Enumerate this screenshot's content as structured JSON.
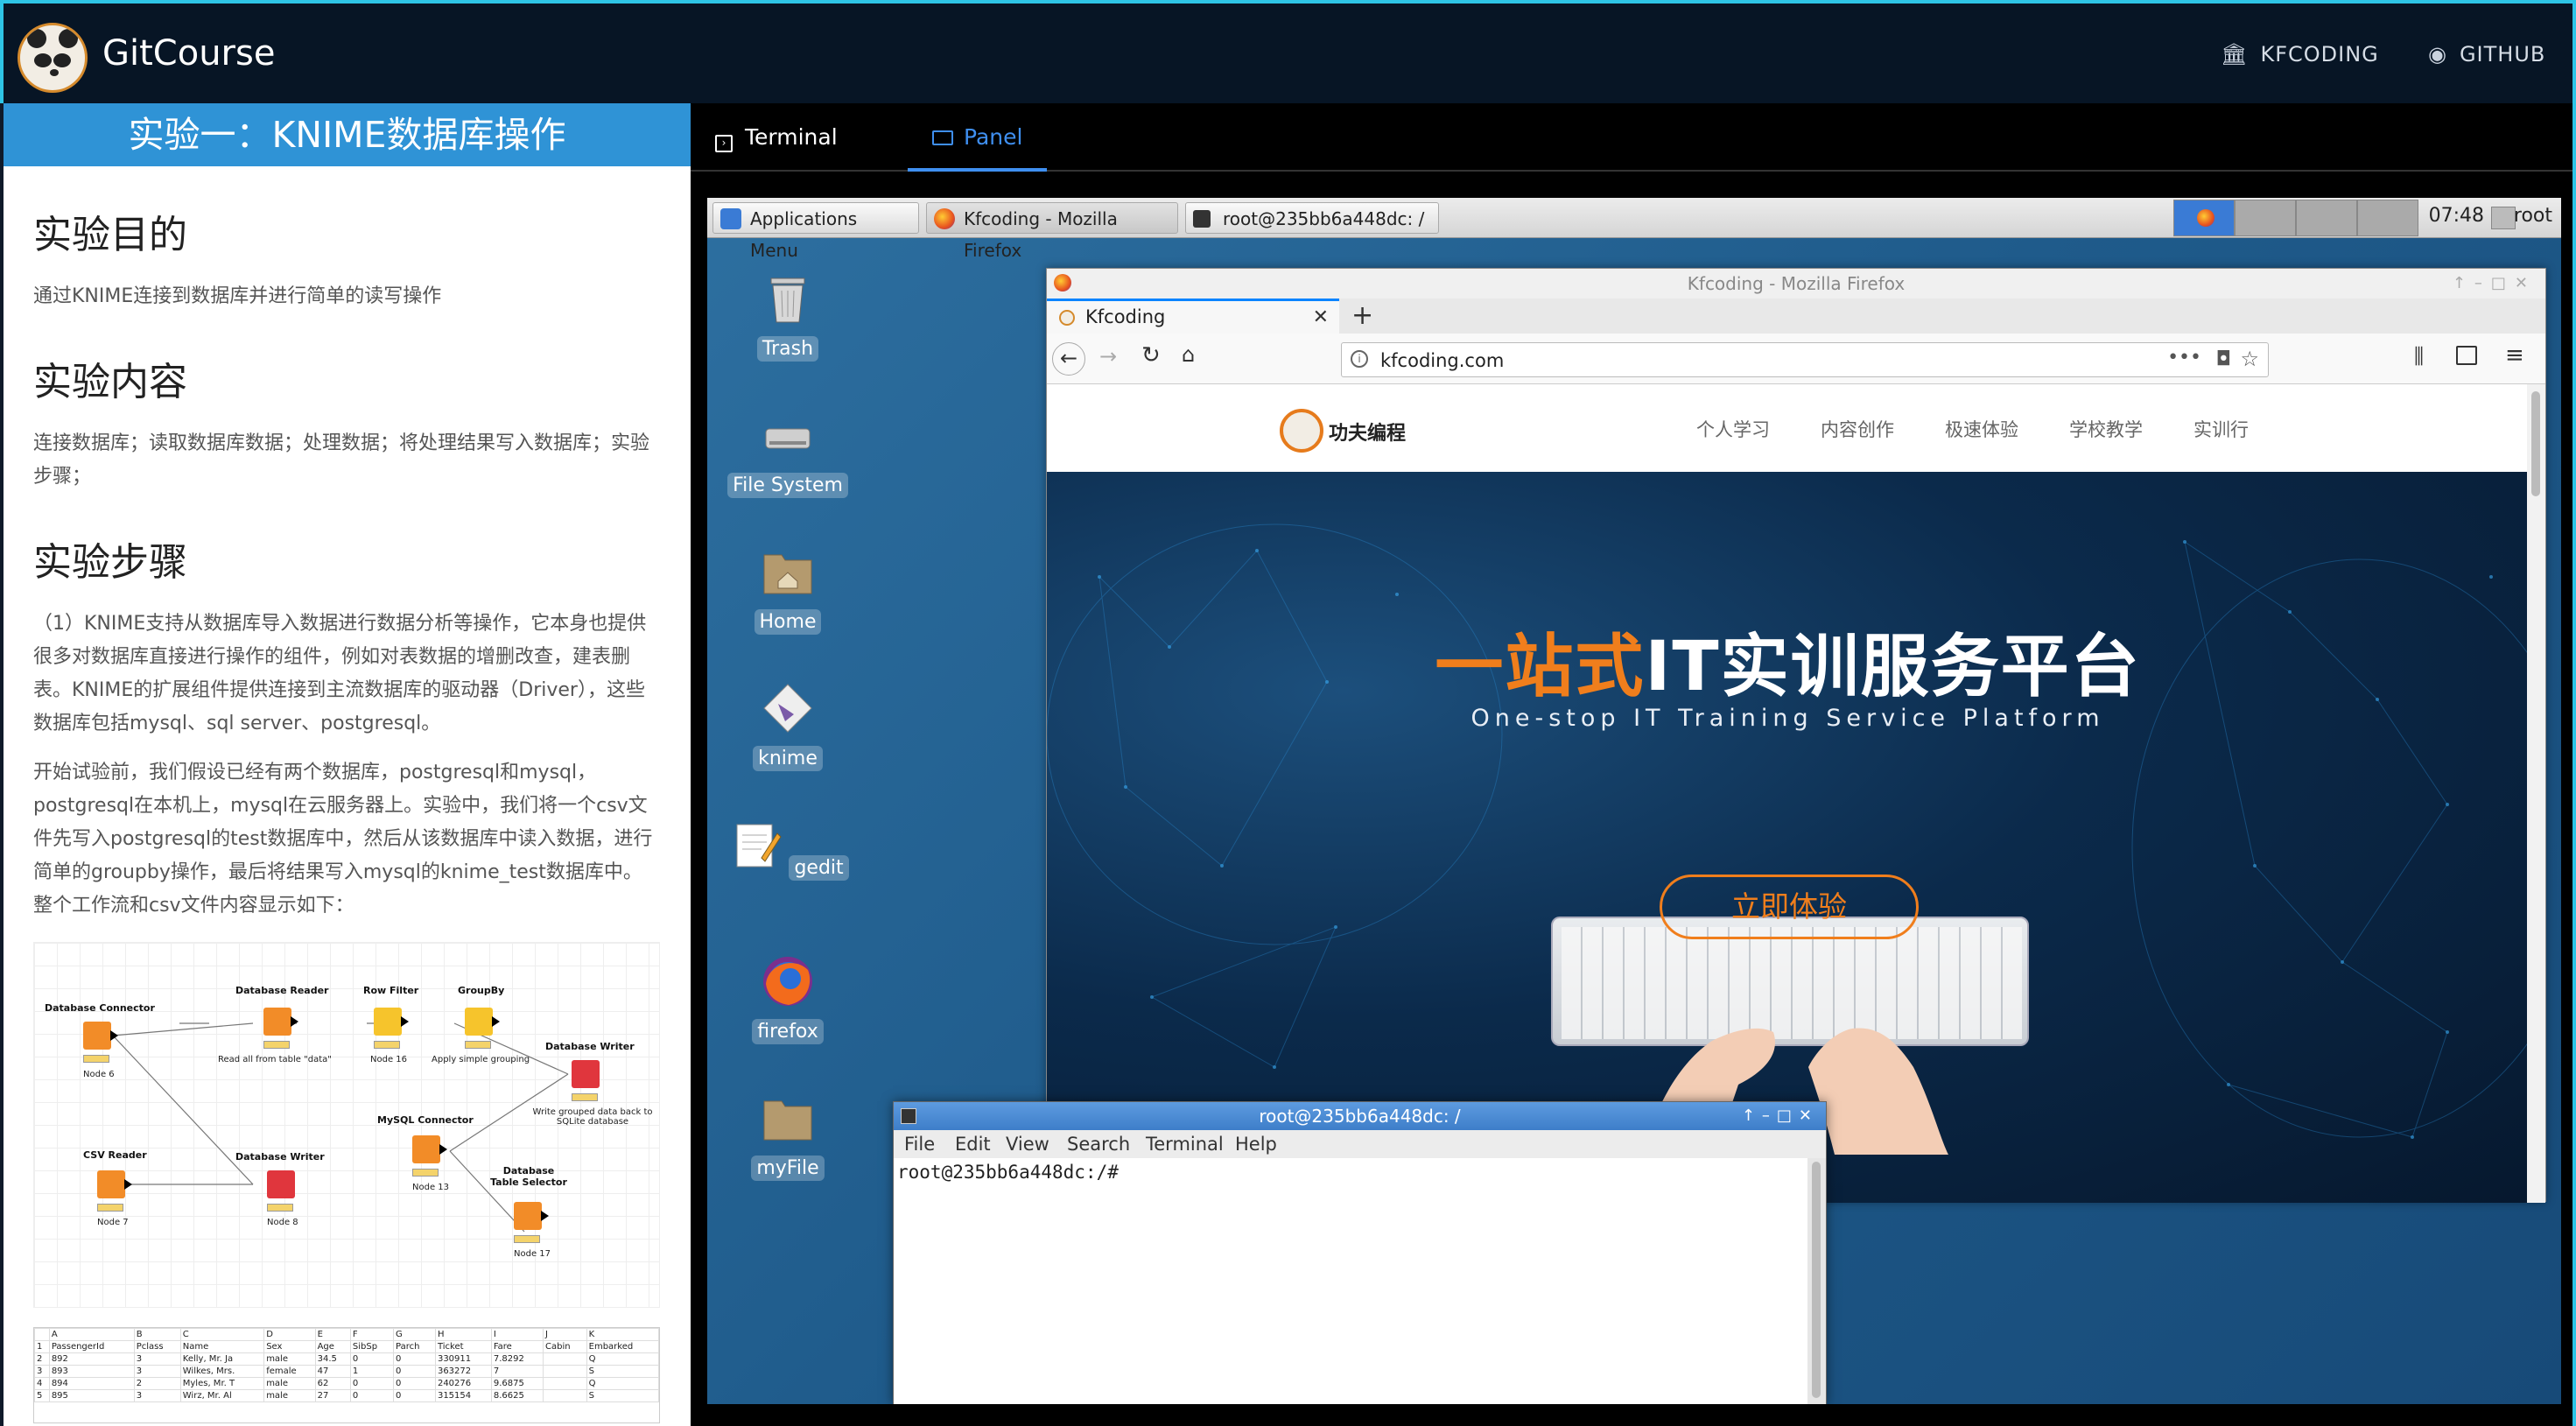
{
  "header": {
    "brand": "GitCourse",
    "links": [
      {
        "label": "KFCODING",
        "icon": "bank-icon"
      },
      {
        "label": "GITHUB",
        "icon": "github-icon"
      }
    ],
    "accent": "#2ec4e6"
  },
  "lesson": {
    "title": "实验一：KNIME数据库操作",
    "sections": [
      {
        "heading": "实验目的",
        "text": "通过KNIME连接到数据库并进行简单的读写操作"
      },
      {
        "heading": "实验内容",
        "text": "连接数据库；读取数据库数据；处理数据；将处理结果写入数据库；实验步骤；"
      },
      {
        "heading": "实验步骤",
        "paragraphs": [
          "（1）KNIME支持从数据库导入数据进行数据分析等操作，它本身也提供很多对数据库直接进行操作的组件，例如对表数据的增删改查，建表删表。KNIME的扩展组件提供连接到主流数据库的驱动器（Driver），这些数据库包括mysql、sql server、postgresql。",
          "开始试验前，我们假设已经有两个数据库，postgresql和mysql，postgresql在本机上，mysql在云服务器上。实验中，我们将一个csv文件先写入postgresql的test数据库中，然后从该数据库中读入数据，进行简单的groupby操作，最后将结果写入mysql的knime_test数据库中。整个工作流和csv文件内容显示如下："
        ]
      }
    ],
    "workflow": {
      "nodes": [
        {
          "title": "Database Connector",
          "sub": "Node 6"
        },
        {
          "title": "Database Reader",
          "sub": "Read all from table \"data\""
        },
        {
          "title": "Row Filter",
          "sub": "Node 16"
        },
        {
          "title": "GroupBy",
          "sub": "Apply simple grouping"
        },
        {
          "title": "Database Writer",
          "sub": "Write grouped data back to SQLite database"
        },
        {
          "title": "MySQL Connector",
          "sub": "Node 13"
        },
        {
          "title": "CSV Reader",
          "sub": "Node 7"
        },
        {
          "title": "Database Writer",
          "sub": "Node 8"
        },
        {
          "title": "Database Table Selector",
          "sub": "Node 17"
        }
      ]
    },
    "csv": {
      "columns": [
        "",
        "A",
        "B",
        "C",
        "D",
        "E",
        "F",
        "G",
        "H",
        "I",
        "J",
        "K"
      ],
      "rows": [
        [
          "1",
          "PassengerId",
          "Pclass",
          "Name",
          "Sex",
          "Age",
          "SibSp",
          "Parch",
          "Ticket",
          "Fare",
          "Cabin",
          "Embarked"
        ],
        [
          "2",
          "892",
          "3",
          "Kelly, Mr. Ja",
          "male",
          "34.5",
          "0",
          "0",
          "330911",
          "7.8292",
          "",
          "Q"
        ],
        [
          "3",
          "893",
          "3",
          "Wilkes, Mrs.",
          "female",
          "47",
          "1",
          "0",
          "363272",
          "7",
          "",
          "S"
        ],
        [
          "4",
          "894",
          "2",
          "Myles, Mr. T",
          "male",
          "62",
          "0",
          "0",
          "240276",
          "9.6875",
          "",
          "Q"
        ],
        [
          "5",
          "895",
          "3",
          "Wirz, Mr. Al",
          "male",
          "27",
          "0",
          "0",
          "315154",
          "8.6625",
          "",
          "S"
        ]
      ]
    }
  },
  "workspace": {
    "tabs": [
      {
        "label": "Terminal",
        "icon": "terminal-icon"
      },
      {
        "label": "Panel",
        "icon": "monitor-icon",
        "active": true
      }
    ],
    "taskbar": {
      "apps_menu": "Applications Menu",
      "windows": [
        "Kfcoding - Mozilla Firefox",
        "root@235bb6a448dc: /"
      ],
      "clock": "07:48",
      "user": "root"
    },
    "desktop_icons": [
      "Trash",
      "File System",
      "Home",
      "knime",
      "gedit",
      "firefox",
      "myFile"
    ],
    "firefox": {
      "window_title": "Kfcoding - Mozilla Firefox",
      "tab_title": "Kfcoding",
      "url": "kfcoding.com",
      "site": {
        "logo_text": "功夫编程",
        "nav": [
          "个人学习",
          "内容创作",
          "极速体验",
          "学校教学",
          "实训行"
        ],
        "hero_title_accent": "一站式",
        "hero_title_rest": "IT实训服务平台",
        "hero_subtitle": "One-stop IT Training Service Platform",
        "cta": "立即体验",
        "accent": "#f07e1c"
      }
    },
    "terminal": {
      "title": "root@235bb6a448dc: /",
      "menu": [
        "File",
        "Edit",
        "View",
        "Search",
        "Terminal",
        "Help"
      ],
      "prompt": "root@235bb6a448dc:/#"
    }
  }
}
